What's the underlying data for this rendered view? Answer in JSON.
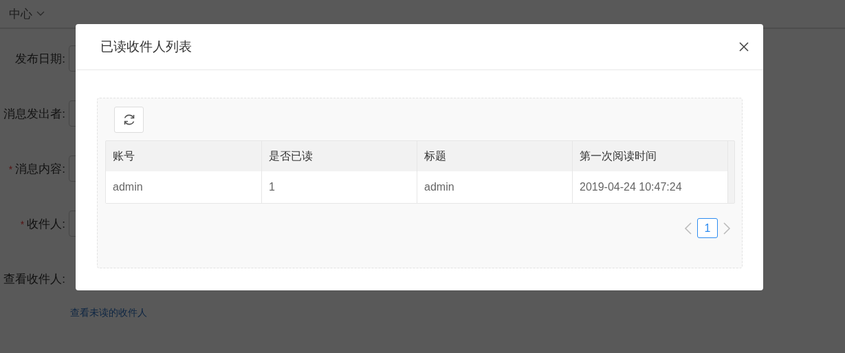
{
  "background_page": {
    "header": {
      "title": "中心"
    },
    "form": [
      {
        "label": "发布日期:",
        "kind": "input"
      },
      {
        "label": "消息发出者:",
        "kind": "input"
      },
      {
        "required_mark": "*",
        "label": "消息内容:",
        "kind": "input"
      },
      {
        "required_mark": "*",
        "label": "收件人:",
        "kind": "input"
      },
      {
        "label": "查看收件人:"
      }
    ],
    "links": [
      "查看未读的收件人"
    ]
  },
  "dialog": {
    "title": "已读收件人列表",
    "table": {
      "columns": [
        "账号",
        "是否已读",
        "标题",
        "第一次阅读时间"
      ],
      "rows": [
        [
          "admin",
          "1",
          "admin",
          "2019-04-24 10:47:24"
        ]
      ]
    },
    "pagination": {
      "prev_disabled": true,
      "next_disabled": true,
      "pages": [
        {
          "label": "1",
          "selected": true
        }
      ]
    }
  }
}
